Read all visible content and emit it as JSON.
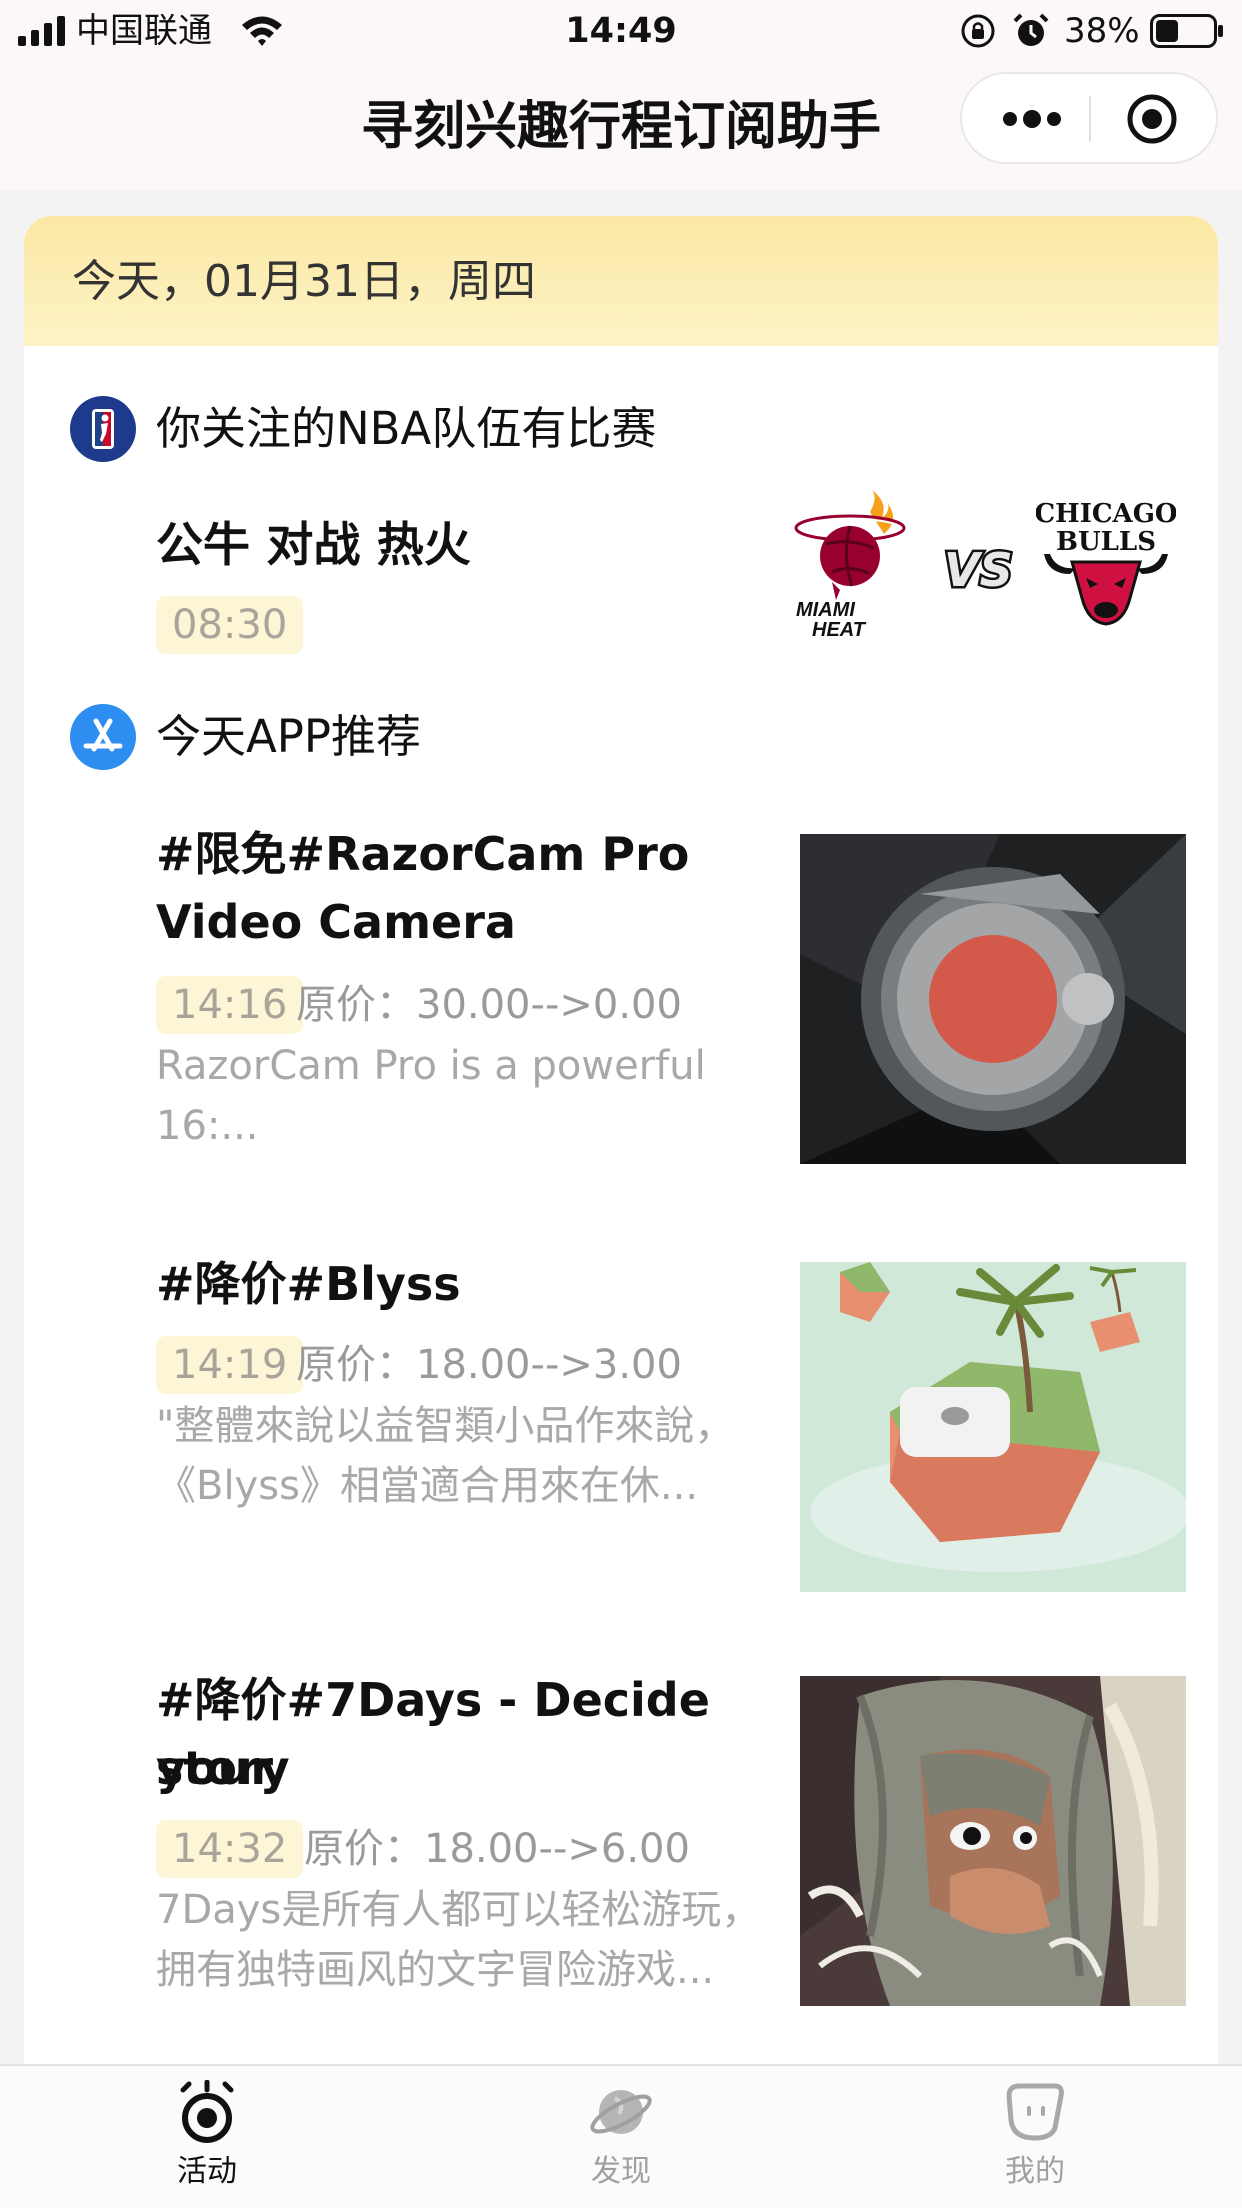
{
  "status_bar": {
    "carrier": "中国联通",
    "time": "14:49",
    "battery": "38%"
  },
  "nav": {
    "title": "寻刻兴趣行程订阅助手"
  },
  "date_header": "今天，01月31日，周四",
  "nba": {
    "section_title": "你关注的NBA队伍有比赛",
    "match_title": "公牛 对战 热火",
    "time": "08:30",
    "home_logo_text": [
      "MIAMI",
      "HEAT"
    ],
    "vs": "VS",
    "away_logo_text": [
      "CHICAGO",
      "BULLS"
    ]
  },
  "apps": {
    "section_title": "今天APP推荐",
    "items": [
      {
        "title_line1": "#限免#RazorCam Pro",
        "title_line2": "Video Camera",
        "time": "14:16",
        "price": "原价：30.00-->0.00",
        "desc_line1": "RazorCam Pro is a powerful",
        "desc_line2": "16:..."
      },
      {
        "title_line1": "#降价#Blyss",
        "time": "14:19",
        "price": "原价：18.00-->3.00",
        "desc_line1": "\"整體來說以益智類小品作來說，",
        "desc_line2": "《Blyss》相當適合用來在休..."
      },
      {
        "title_line1": "#降价#7Days - Decide your",
        "title_line2": "story",
        "time": "14:32",
        "price": "原价：18.00-->6.00",
        "desc_line1": "7Days是所有人都可以轻松游玩，",
        "desc_line2": "拥有独特画风的文字冒险游戏..."
      }
    ]
  },
  "tabbar": {
    "tabs": [
      {
        "label": "活动",
        "icon": "activity-icon",
        "active": true
      },
      {
        "label": "发现",
        "icon": "planet-icon",
        "active": false
      },
      {
        "label": "我的",
        "icon": "profile-icon",
        "active": false
      }
    ],
    "active_color": "#111111",
    "inactive_color": "#a0a0a0"
  }
}
